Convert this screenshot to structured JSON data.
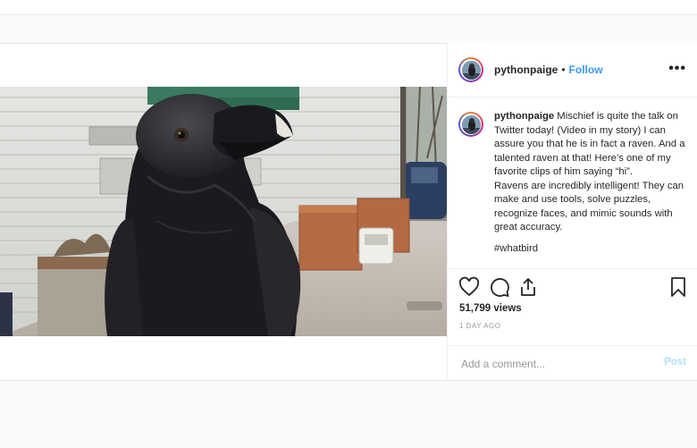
{
  "post": {
    "username": "pythonpaige",
    "separator": "•",
    "follow_label": "Follow",
    "more_label": "•••",
    "caption": {
      "username": "pythonpaige",
      "text": "Mischief is quite the talk on Twitter today! (Video in my story) I can assure you that he is in fact a raven. And a talented raven at that! Here’s one of my favorite clips of him saying “hi”.\nRavens are incredibly intelligent! They can make and use tools, solve puzzles, recognize faces, and mimic sounds with great accuracy.",
      "tail": "#whatbird"
    },
    "views": "51,799 views",
    "date": "1 DAY AGO",
    "comment": {
      "placeholder": "Add a comment...",
      "post_label": "Post"
    }
  },
  "icons": {
    "like": "heart-icon",
    "comment": "comment-bubble-icon",
    "share": "share-icon",
    "save": "bookmark-icon",
    "more": "more-dots-icon"
  },
  "colors": {
    "link": "#3897f0",
    "post_disabled": "#b2dffc",
    "muted": "#999999",
    "text": "#262626"
  }
}
